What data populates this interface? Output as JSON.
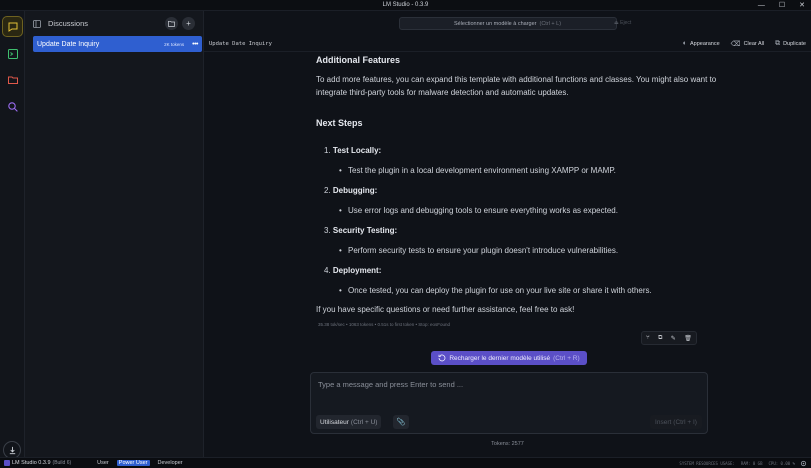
{
  "window": {
    "title": "LM Studio - 0.3.9",
    "controls": [
      "—",
      "☐",
      "✕"
    ]
  },
  "rail": {
    "items": [
      "chat-icon",
      "terminal-icon",
      "folder-icon",
      "search-icon"
    ],
    "download_icon": "download-icon",
    "colors": {
      "chat": "#e3c038",
      "terminal": "#3fbf6f",
      "folder": "#e0584a",
      "search": "#9a6cf0"
    }
  },
  "sidebar": {
    "title": "Discussions",
    "new_folder_icon": "+",
    "new_chat_icon": "+",
    "chats": [
      {
        "name": "Update Date Inquiry",
        "tokens": "2K tokens",
        "more": "•••"
      }
    ]
  },
  "topbar": {
    "model_select": "Sélectionner un modèle à charger",
    "model_hint": "(Ctrl + L)",
    "eject": "⏏ Eject"
  },
  "subbar": {
    "chat_name": "Update Date Inquiry",
    "appearance": "Appearance",
    "clear_all": "Clear All",
    "duplicate": "Duplicate"
  },
  "message": {
    "heading_additional": "Additional Features",
    "para_additional": "To add more features, you can expand this template with additional functions and classes. You might also want to integrate third-party tools for malware detection and automatic updates.",
    "heading_next": "Next Steps",
    "steps": [
      {
        "num": "1.",
        "title": "Test Locally:",
        "bullet": "Test the plugin in a local development environment using XAMPP or MAMP."
      },
      {
        "num": "2.",
        "title": "Debugging:",
        "bullet": "Use error logs and debugging tools to ensure everything works as expected."
      },
      {
        "num": "3.",
        "title": "Security Testing:",
        "bullet": "Perform security tests to ensure your plugin doesn't introduce vulnerabilities."
      },
      {
        "num": "4.",
        "title": "Deployment:",
        "bullet": "Once tested, you can deploy the plugin for use on your live site or share it with others."
      }
    ],
    "closing": "If you have specific questions or need further assistance, feel free to ask!",
    "stats": "35.38 tok/sec  •  1063 tokens  •  0.51s to first token  •  Stop: eosFound"
  },
  "reload": {
    "label": "Recharger le dernier modèle utilisé",
    "hint": "(Ctrl + R)"
  },
  "composer": {
    "placeholder": "Type a message and press Enter to send ...",
    "role_label": "Utilisateur",
    "role_hint": "(Ctrl + U)",
    "insert_label": "Insert",
    "insert_hint": "(Ctrl + I)"
  },
  "tokens": "Tokens: 2577",
  "status": {
    "brand": "LM Studio 0.3.9",
    "build": "(Build 6)",
    "modes": [
      "User",
      "Power User",
      "Developer"
    ],
    "active_mode": "Power User",
    "system": "SYSTEM RESOURCES USAGE:",
    "ram": "RAM: 0 GB",
    "cpu": "CPU: 0.00 %"
  }
}
